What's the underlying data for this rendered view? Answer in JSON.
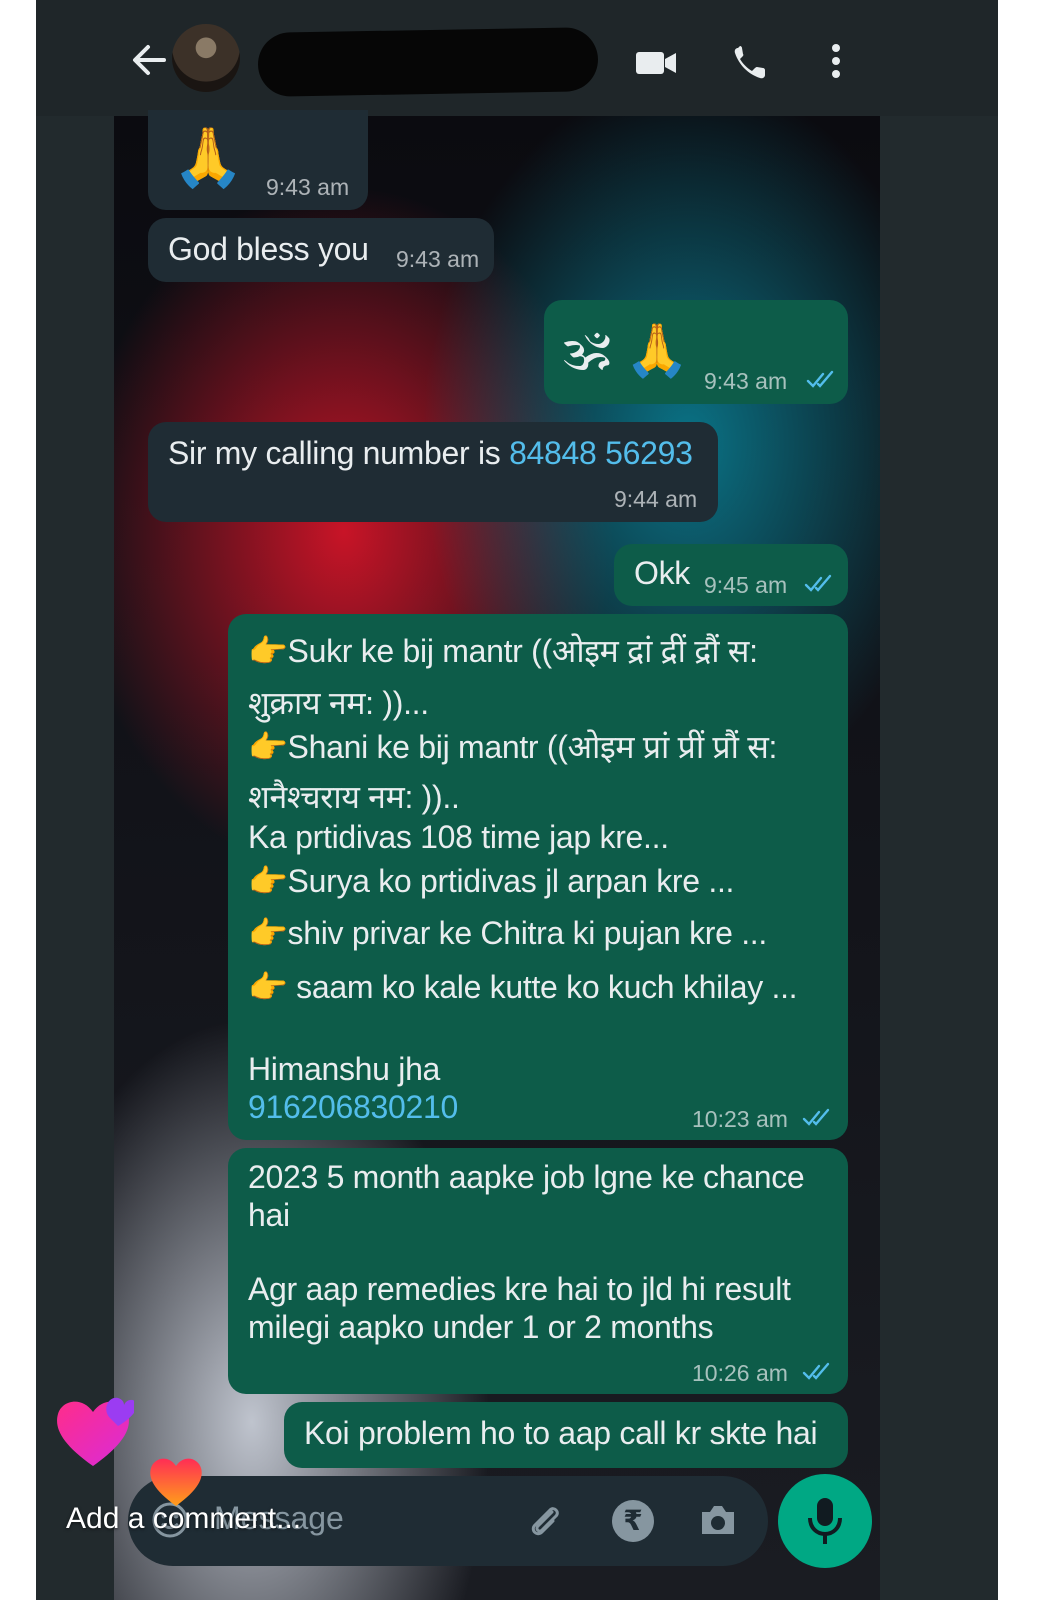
{
  "header": {
    "back_icon": "arrow-left-icon",
    "video_icon": "video-call-icon",
    "call_icon": "phone-icon",
    "menu_icon": "more-vertical-icon"
  },
  "messages": [
    {
      "dir": "in",
      "emoji": "🙏",
      "time": "9:43 am"
    },
    {
      "dir": "in",
      "text": "God bless you",
      "time": "9:43 am"
    },
    {
      "dir": "out",
      "emoji": "🕉 🙏",
      "time": "9:43 am"
    },
    {
      "dir": "in",
      "text": "Sir my calling number is ",
      "link": "84848 56293",
      "time": "9:44 am"
    },
    {
      "dir": "out",
      "text": "Okk",
      "time": "9:45 am"
    },
    {
      "dir": "out",
      "lines": [
        "👉Sukr ke bij mantr ((ओइम द्रां द्रीं द्रौं स:",
        "शुक्राय नम: ))...",
        "👉Shani ke bij mantr ((ओइम प्रां प्रीं  प्रौं स:",
        "शनैश्चराय नम: ))..",
        "Ka prtidivas 108 time jap kre...",
        "👉Surya ko prtidivas jl arpan kre ...",
        "👉shiv privar ke Chitra ki pujan kre ...",
        "👉 saam ko kale kutte ko kuch khilay ...",
        "",
        "Himanshu jha"
      ],
      "link": "916206830210",
      "time": "10:23 am"
    },
    {
      "dir": "out",
      "lines": [
        "2023 5 month aapke  job lgne ke chance",
        "hai",
        "",
        "Agr aap remedies kre hai to jld hi result",
        "milegi aapko under 1 or 2 months"
      ],
      "time": "10:26 am"
    },
    {
      "dir": "out",
      "text": "Koi problem ho to aap call kr skte hai"
    }
  ],
  "composer": {
    "placeholder": "Message",
    "emoji_icon": "emoji-icon",
    "attach_icon": "paperclip-icon",
    "rupee_icon": "rupee-icon",
    "rupee_glyph": "₹",
    "camera_icon": "camera-icon",
    "mic_icon": "microphone-icon"
  },
  "overlay": {
    "comment": "Add a comment..."
  },
  "colors": {
    "incoming_bubble": "#1f2c34",
    "outgoing_bubble": "#0d5c49",
    "link": "#53bdeb",
    "accent": "#00a884"
  }
}
